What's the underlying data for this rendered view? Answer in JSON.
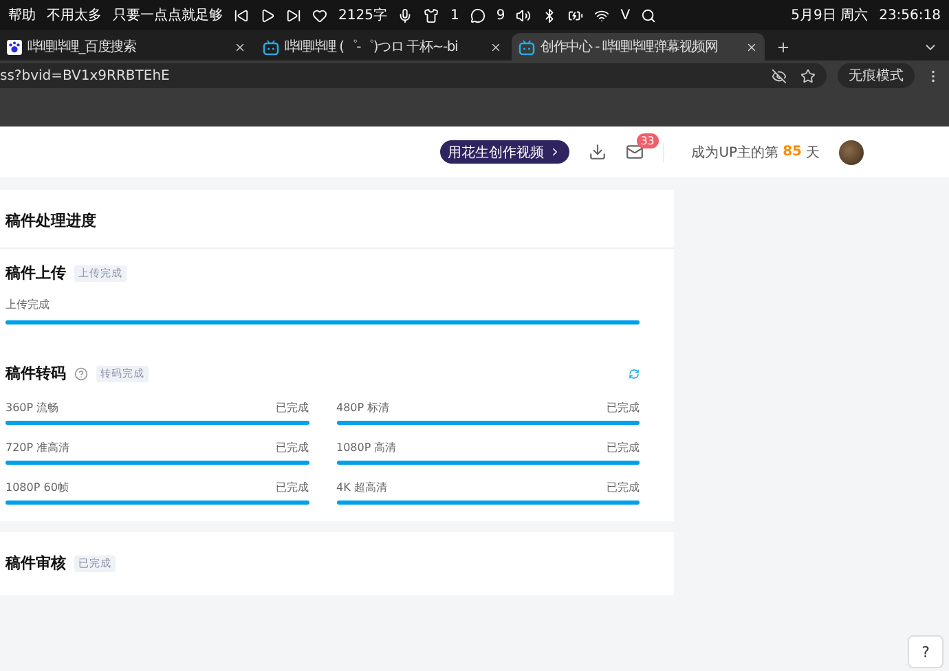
{
  "menu_bar": {
    "app_menu": [
      "帮助"
    ],
    "lyrics": "不用太多",
    "lyrics_2": "只要一点点就足够",
    "word_count": "2125字",
    "shirt_count": "1",
    "wechat_count": "9",
    "input_method": "V",
    "date": "5月9日 周六",
    "time": "23:56:18"
  },
  "tabs": [
    {
      "title": "哔哩哔哩_百度搜索",
      "selected": false,
      "kind": "baidu"
    },
    {
      "title": "哔哩哔哩 (゜-゜)つロ 干杯~-bi",
      "selected": false,
      "kind": "bili"
    },
    {
      "title": "创作中心 - 哔哩哔哩弹幕视频网",
      "selected": true,
      "kind": "bili"
    }
  ],
  "address_bar": {
    "url": "ss?bvid=BV1x9RRBTEhE",
    "incognito_label": "无痕模式"
  },
  "header": {
    "create_button": "用花生创作视频",
    "message_badge": "33",
    "up_days_prefix": "成为UP主的第",
    "up_days": "85",
    "up_days_suffix": "天"
  },
  "progress_card": {
    "title": "稿件处理进度",
    "upload": {
      "title": "稿件上传",
      "tag": "上传完成",
      "label": "上传完成",
      "level": 1
    },
    "transcode": {
      "title": "稿件转码",
      "tag": "转码完成",
      "items": [
        {
          "name": "360P 流畅",
          "status": "已完成",
          "level": 1
        },
        {
          "name": "480P 标清",
          "status": "已完成",
          "level": 1
        },
        {
          "name": "720P 准高清",
          "status": "已完成",
          "level": 1
        },
        {
          "name": "1080P 高清",
          "status": "已完成",
          "level": 1
        },
        {
          "name": "1080P 60帧",
          "status": "已完成",
          "level": 1
        },
        {
          "name": "4K 超高清",
          "status": "已完成",
          "level": 1
        }
      ]
    }
  },
  "review_card": {
    "title": "稿件审核",
    "tag": "已完成"
  },
  "help_button": "?"
}
